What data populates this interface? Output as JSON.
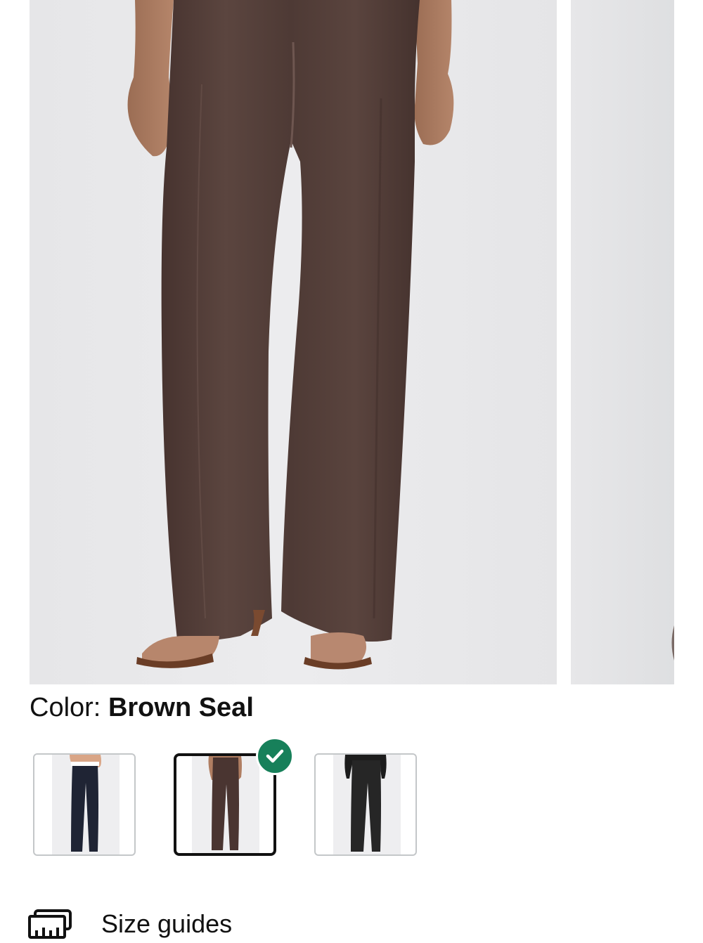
{
  "product": {
    "color_label": "Color:",
    "color_value": "Brown Seal",
    "selected_swatch": "Brown Seal"
  },
  "swatches": [
    {
      "name": "Navy",
      "color": "#1f2434"
    },
    {
      "name": "Brown Seal",
      "color": "#4a3531"
    },
    {
      "name": "Black",
      "color": "#262626"
    }
  ],
  "size_guides": {
    "label": "Size guides",
    "icon": "ruler-icon"
  },
  "colors": {
    "pant_brown": "#54403b",
    "check_green": "#17805a",
    "border_gray": "#c4c7c9"
  }
}
